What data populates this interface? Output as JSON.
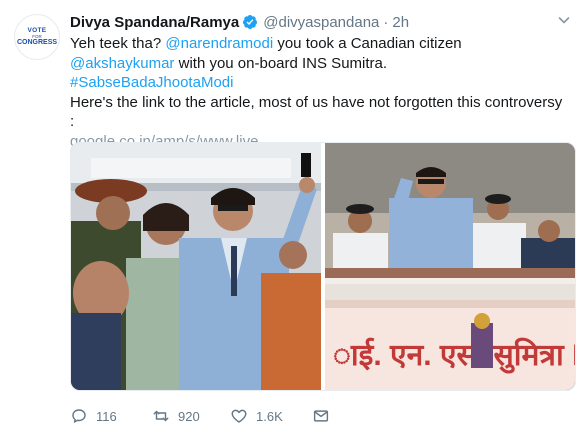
{
  "avatar": {
    "line1": "VOTE",
    "line2": "FOR",
    "line3": "CONGRESS"
  },
  "author": {
    "name": "Divya Spandana/Ramya",
    "handle": "@divyaspandana",
    "separator": "·",
    "time": "2h"
  },
  "body": {
    "line1_pre": "Yeh teek tha? ",
    "mention1": "@narendramodi",
    "line1_mid": " you took a Canadian citizen ",
    "mention2": "@akshaykumar",
    "line1_post": " with you on-board INS Sumitra.",
    "hashtag": "#SabseBadaJhootaModi",
    "line3": "Here's the link to the article, most of us have not forgotten this controversy :",
    "url": "google.co.in/amp/s/www.live…"
  },
  "media": {
    "banner_text": "ाई. एन. एस. सुमित्रा   INS"
  },
  "actions": {
    "replies": "116",
    "retweets": "920",
    "likes": "1.6K"
  },
  "colors": {
    "accent": "#1da1f2",
    "secondary_text": "#657786",
    "verified": "#1da1f2"
  }
}
